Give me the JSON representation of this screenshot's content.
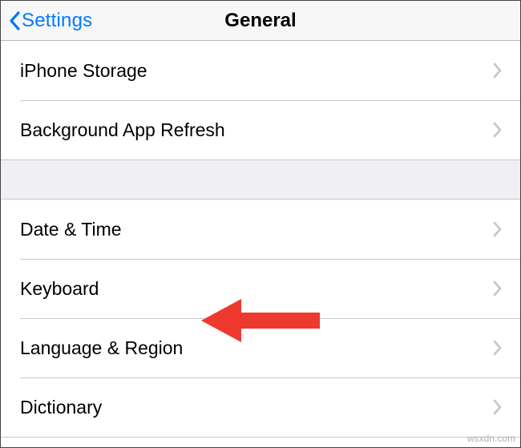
{
  "nav": {
    "back_label": "Settings",
    "title": "General"
  },
  "sections": [
    {
      "rows": [
        {
          "label": "iPhone Storage"
        },
        {
          "label": "Background App Refresh"
        }
      ]
    },
    {
      "rows": [
        {
          "label": "Date & Time"
        },
        {
          "label": "Keyboard"
        },
        {
          "label": "Language & Region"
        },
        {
          "label": "Dictionary"
        }
      ]
    }
  ],
  "annotation": {
    "color": "#ee3a2e"
  },
  "watermark": "wsxdn.com"
}
